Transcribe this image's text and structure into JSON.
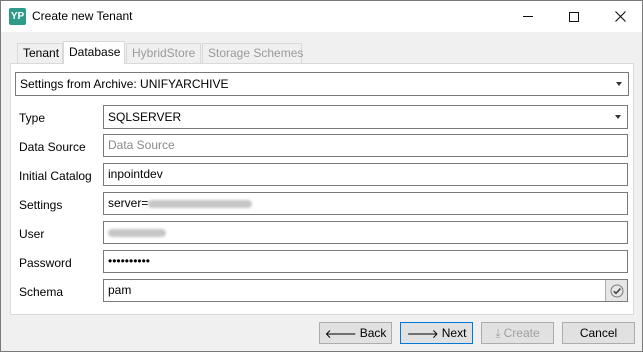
{
  "window": {
    "icon_text": "YP",
    "title": "Create new Tenant",
    "minimize_icon": "minimize-icon",
    "maximize_icon": "maximize-icon",
    "close_icon": "close-icon"
  },
  "tabs": [
    {
      "label": "Tenant",
      "state": "normal"
    },
    {
      "label": "Database",
      "state": "active"
    },
    {
      "label": "HybridStore",
      "state": "disabled"
    },
    {
      "label": "Storage Schemes",
      "state": "disabled"
    }
  ],
  "settings_source": {
    "selected": "Settings from Archive: UNIFYARCHIVE"
  },
  "form": {
    "type": {
      "label": "Type",
      "value": "SQLSERVER"
    },
    "data_source": {
      "label": "Data Source",
      "value": "",
      "placeholder": "Data Source"
    },
    "initial_catalog": {
      "label": "Initial Catalog",
      "value": "inpointdev"
    },
    "settings": {
      "label": "Settings",
      "value": "server="
    },
    "user": {
      "label": "User",
      "value": ""
    },
    "password": {
      "label": "Password",
      "value": "••••••••••"
    },
    "schema": {
      "label": "Schema",
      "value": "pam",
      "check_icon": "checkmark-icon"
    }
  },
  "buttons": {
    "back": {
      "label": "Back",
      "icon": "arrow-left-icon",
      "glyph": "🡐"
    },
    "next": {
      "label": "Next",
      "icon": "arrow-right-icon",
      "glyph": "🡒"
    },
    "create": {
      "label": "Create",
      "icon": "download-icon",
      "glyph": "⤓"
    },
    "cancel": {
      "label": "Cancel"
    }
  },
  "colors": {
    "accent": "#0078d7",
    "app_icon": "#2e9a8a"
  }
}
